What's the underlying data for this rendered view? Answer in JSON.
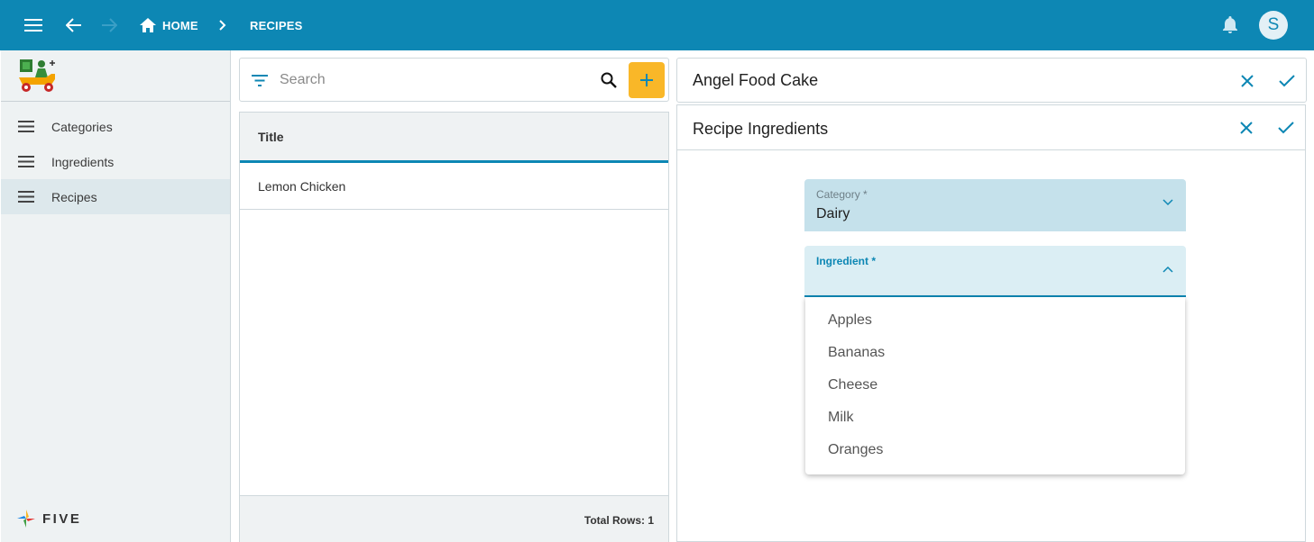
{
  "topbar": {
    "breadcrumb_home": "HOME",
    "breadcrumb_current": "RECIPES",
    "avatar_initial": "S"
  },
  "sidebar": {
    "items": [
      {
        "label": "Categories",
        "icon": "menu-lines-icon"
      },
      {
        "label": "Ingredients",
        "icon": "menu-lines-icon"
      },
      {
        "label": "Recipes",
        "icon": "menu-lines-icon",
        "active": true
      }
    ],
    "brand": "FIVE"
  },
  "list": {
    "search_placeholder": "Search",
    "column_title": "Title",
    "rows": [
      "Lemon Chicken"
    ],
    "footer": "Total Rows: 1"
  },
  "record": {
    "title": "Angel Food Cake",
    "subform_title": "Recipe Ingredients",
    "category_label": "Category *",
    "category_value": "Dairy",
    "ingredient_label": "Ingredient *",
    "ingredient_options": [
      "Apples",
      "Bananas",
      "Cheese",
      "Milk",
      "Oranges"
    ]
  },
  "colors": {
    "primary": "#0d87b4",
    "accent": "#f9b728",
    "sidebar_bg": "#eef2f3"
  }
}
